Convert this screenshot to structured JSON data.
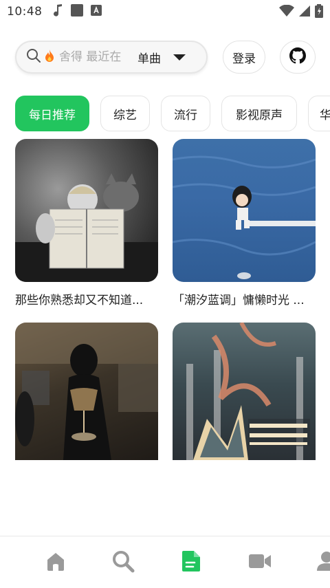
{
  "status_bar": {
    "time": "10:48"
  },
  "search": {
    "placeholder": "舍得 最近在",
    "type_label": "单曲"
  },
  "header": {
    "login_label": "登录"
  },
  "categories": [
    {
      "label": "每日推荐",
      "active": true
    },
    {
      "label": "综艺",
      "active": false
    },
    {
      "label": "流行",
      "active": false
    },
    {
      "label": "影视原声",
      "active": false
    },
    {
      "label": "华",
      "active": false
    }
  ],
  "playlists": [
    {
      "title": "那些你熟悉却又不知道..."
    },
    {
      "title": "「潮汐蓝调」慵懒时光 ..."
    },
    {
      "title": ""
    },
    {
      "title": ""
    }
  ],
  "colors": {
    "accent": "#22c55e",
    "nav_inactive": "#9a9a9a"
  },
  "bottom_nav": {
    "items": [
      "home-icon",
      "search-icon",
      "document-icon",
      "video-icon",
      "user-icon"
    ],
    "active_index": 2
  }
}
